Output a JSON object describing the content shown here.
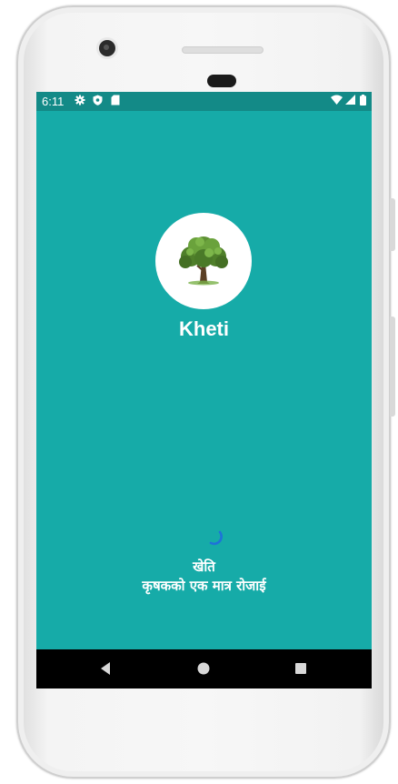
{
  "statusbar": {
    "time": "6:11",
    "icons": [
      "gear-icon",
      "shield-icon",
      "sd-card-icon",
      "wifi-icon",
      "signal-icon",
      "battery-icon"
    ]
  },
  "splash": {
    "app_name": "Kheti",
    "tagline_line1": "खेति",
    "tagline_line2": "कृषकको एक मात्र रोजाई",
    "background_color": "#16aba8",
    "statusbar_color": "#138a87",
    "logo_icon": "tree-icon",
    "loading_indicator": "spinner-icon"
  },
  "navbar": {
    "buttons": [
      "back-icon",
      "home-icon",
      "recent-apps-icon"
    ]
  }
}
